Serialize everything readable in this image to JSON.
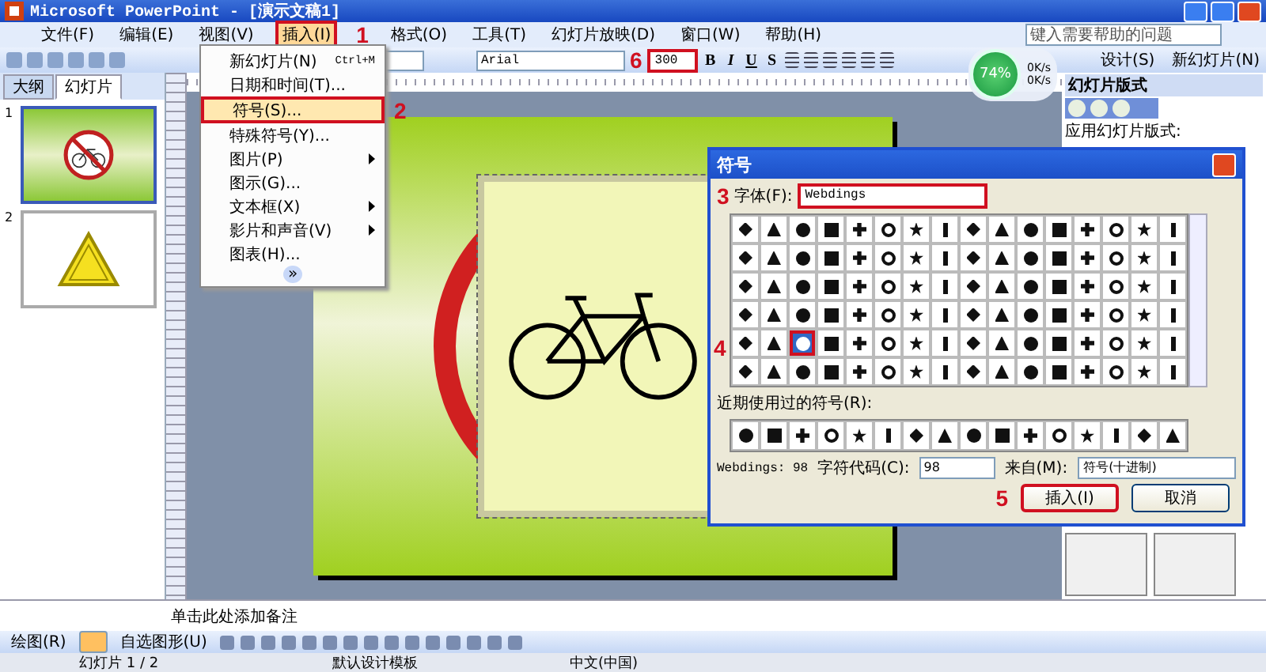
{
  "window": {
    "title": "Microsoft PowerPoint - [演示文稿1]"
  },
  "menu_bar": {
    "items": [
      {
        "label": "文件(F)",
        "selected": false
      },
      {
        "label": "编辑(E)",
        "selected": false
      },
      {
        "label": "视图(V)",
        "selected": false
      },
      {
        "label": "插入(I)",
        "selected": true
      },
      {
        "label": "格式(O)",
        "selected": false
      },
      {
        "label": "工具(T)",
        "selected": false
      },
      {
        "label": "幻灯片放映(D)",
        "selected": false
      },
      {
        "label": "窗口(W)",
        "selected": false
      },
      {
        "label": "帮助(H)",
        "selected": false
      }
    ],
    "help_search": {
      "placeholder": "键入需要帮助的问题"
    }
  },
  "toolbar": {
    "font": "Arial",
    "font_size": "300",
    "format_buttons": [
      "B",
      "I",
      "U",
      "S"
    ],
    "design_button": "设计(S)",
    "new_slide_button": "新幻灯片(N)"
  },
  "network_widget": {
    "percent": "74%",
    "upload": "0K/s",
    "download": "0K/s"
  },
  "slides_pane": {
    "tabs": [
      {
        "label": "大纲",
        "selected": false
      },
      {
        "label": "幻灯片",
        "selected": true
      }
    ],
    "slides": [
      {
        "number": "1",
        "selected": true,
        "kind": "no-bike"
      },
      {
        "number": "2",
        "selected": false,
        "kind": "triangle"
      }
    ]
  },
  "insert_menu": {
    "items": [
      {
        "label": "新幻灯片(N)",
        "shortcut": "Ctrl+M",
        "submenu": false,
        "highlighted": false
      },
      {
        "label": "日期和时间(T)...",
        "submenu": false,
        "highlighted": false
      },
      {
        "label": "符号(S)...",
        "submenu": false,
        "highlighted": true
      },
      {
        "label": "特殊符号(Y)...",
        "submenu": false,
        "highlighted": false
      },
      {
        "label": "图片(P)",
        "submenu": true,
        "highlighted": false
      },
      {
        "label": "图示(G)...",
        "submenu": false,
        "highlighted": false
      },
      {
        "label": "文本框(X)",
        "submenu": true,
        "highlighted": false
      },
      {
        "label": "影片和声音(V)",
        "submenu": true,
        "highlighted": false
      },
      {
        "label": "图表(H)...",
        "submenu": false,
        "highlighted": false
      }
    ],
    "expand": "»"
  },
  "task_pane": {
    "title": "幻灯片版式",
    "label": "应用幻灯片版式:"
  },
  "symbol_dialog": {
    "title": "符号",
    "font_label": "字体(F):",
    "font": "Webdings",
    "cells": [
      {
        "selected": false
      },
      {
        "selected": false
      },
      {
        "selected": false
      },
      {
        "selected": false
      },
      {
        "selected": false
      },
      {
        "selected": false
      },
      {
        "selected": false
      },
      {
        "selected": false
      },
      {
        "selected": false
      },
      {
        "selected": false
      },
      {
        "selected": false
      },
      {
        "selected": false
      },
      {
        "selected": false
      },
      {
        "selected": false
      },
      {
        "selected": false
      },
      {
        "selected": false
      },
      {
        "selected": false
      },
      {
        "selected": false
      },
      {
        "selected": false
      },
      {
        "selected": false
      },
      {
        "selected": false
      },
      {
        "selected": false
      },
      {
        "selected": false
      },
      {
        "selected": false
      },
      {
        "selected": false
      },
      {
        "selected": false
      },
      {
        "selected": false
      },
      {
        "selected": false
      },
      {
        "selected": false
      },
      {
        "selected": false
      },
      {
        "selected": false
      },
      {
        "selected": false
      },
      {
        "selected": false
      },
      {
        "selected": false
      },
      {
        "selected": false
      },
      {
        "selected": false
      },
      {
        "selected": false
      },
      {
        "selected": false
      },
      {
        "selected": false
      },
      {
        "selected": false
      },
      {
        "selected": false
      },
      {
        "selected": false
      },
      {
        "selected": false
      },
      {
        "selected": false
      },
      {
        "selected": false
      },
      {
        "selected": false
      },
      {
        "selected": false
      },
      {
        "selected": false
      },
      {
        "selected": false
      },
      {
        "selected": false
      },
      {
        "selected": false
      },
      {
        "selected": false
      },
      {
        "selected": false
      },
      {
        "selected": false
      },
      {
        "selected": false
      },
      {
        "selected": false
      },
      {
        "selected": false
      },
      {
        "selected": false
      },
      {
        "selected": false
      },
      {
        "selected": false
      },
      {
        "selected": false
      },
      {
        "selected": false
      },
      {
        "selected": false
      },
      {
        "selected": false
      },
      {
        "selected": false
      },
      {
        "selected": false
      },
      {
        "selected": true
      },
      {
        "selected": false
      },
      {
        "selected": false
      },
      {
        "selected": false
      },
      {
        "selected": false
      },
      {
        "selected": false
      },
      {
        "selected": false
      },
      {
        "selected": false
      },
      {
        "selected": false
      },
      {
        "selected": false
      },
      {
        "selected": false
      },
      {
        "selected": false
      },
      {
        "selected": false
      },
      {
        "selected": false
      },
      {
        "selected": false
      },
      {
        "selected": false
      },
      {
        "selected": false
      },
      {
        "selected": false
      },
      {
        "selected": false
      },
      {
        "selected": false
      },
      {
        "selected": false
      },
      {
        "selected": false
      },
      {
        "selected": false
      },
      {
        "selected": false
      },
      {
        "selected": false
      },
      {
        "selected": false
      },
      {
        "selected": false
      },
      {
        "selected": false
      },
      {
        "selected": false
      },
      {
        "selected": false
      }
    ],
    "recent_label": "近期使用过的符号(R):",
    "status": "Webdings: 98",
    "code_label": "字符代码(C):",
    "code": "98",
    "from_label": "来自(M):",
    "from": "符号(十进制)",
    "insert_button": "插入(I)",
    "cancel_button": "取消"
  },
  "notes": {
    "placeholder": "单击此处添加备注"
  },
  "drawing_toolbar": {
    "draw": "绘图(R)",
    "autoshapes": "自选图形(U)"
  },
  "status_bar": {
    "slide": "幻灯片 1 / 2",
    "template": "默认设计模板",
    "language": "中文(中国)"
  },
  "annotations": [
    "1",
    "2",
    "3",
    "4",
    "5",
    "6"
  ]
}
